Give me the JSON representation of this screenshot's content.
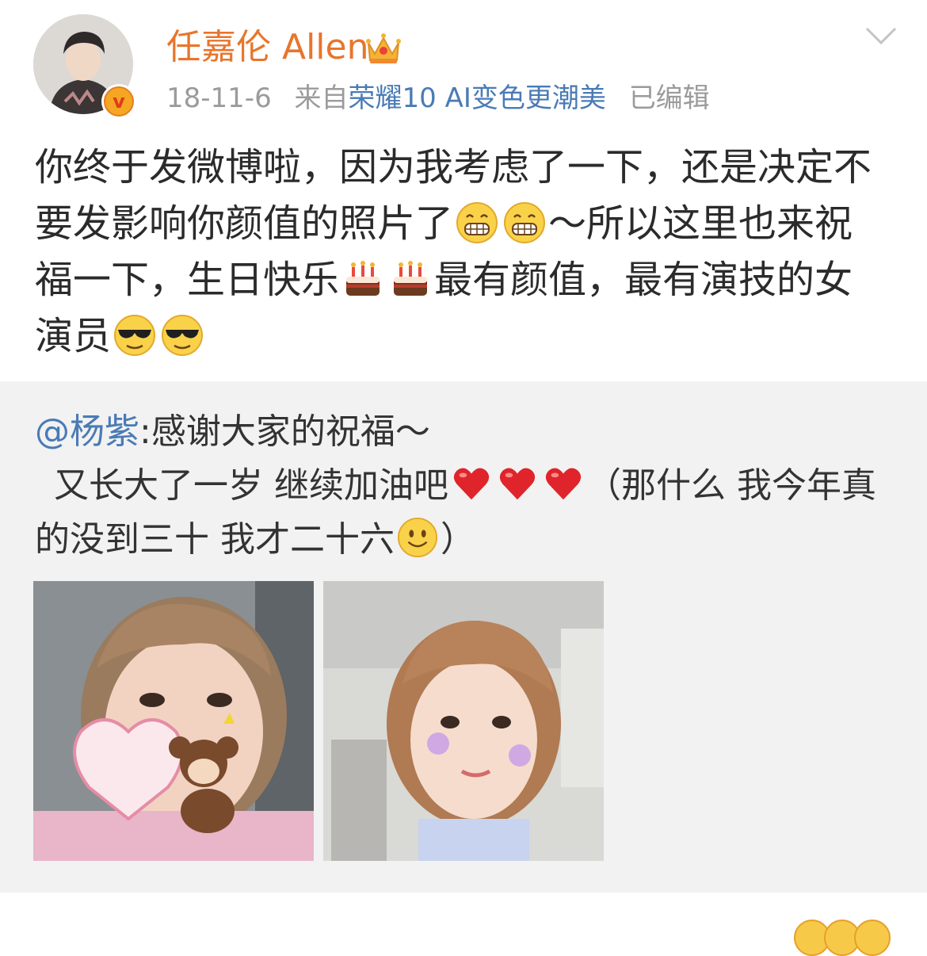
{
  "post": {
    "author": "任嘉伦 Allen",
    "date": "18-11-6",
    "from_prefix": "来自",
    "source": "荣耀10 AI变色更潮美",
    "edited": "已编辑",
    "text": {
      "seg1": "你终于发微博啦，因为我考虑了一下，还是决定不要发影响你颜值的照片了",
      "seg2": "～所以这里也来祝福一下，生日快乐",
      "seg3": "最有颜值，最有演技的女演员"
    }
  },
  "repost": {
    "mention": "@杨紫",
    "text1": ":感谢大家的祝福～",
    "text2": "又长大了一岁 继续加油吧",
    "text3": "（那什么 我今年真的没到三十 我才二十六",
    "text4": "）"
  },
  "icons": [
    "crown-icon",
    "verified-icon",
    "chevron-down-icon",
    "grin-emoji",
    "cake-emoji",
    "cool-emoji",
    "heart-emoji",
    "smile-emoji"
  ],
  "colors": {
    "username": "#e8752c",
    "link": "#4a7bb5",
    "meta": "#9b9b9b",
    "repost_bg": "#f2f2f2"
  }
}
